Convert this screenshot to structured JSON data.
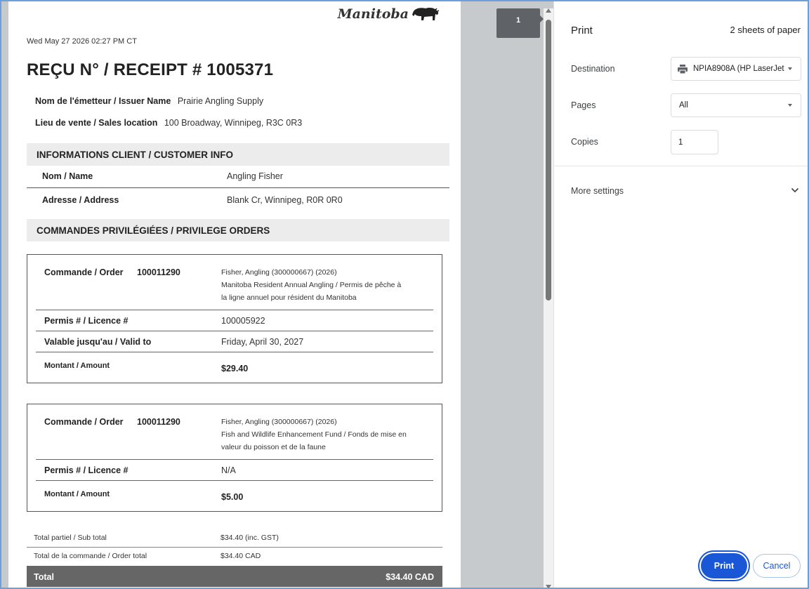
{
  "page": {
    "brand": "Manitoba",
    "timestamp": "Wed May 27 2026 02:27 PM CT",
    "receipt_title": "REÇU N° / RECEIPT # 1005371",
    "issuer": {
      "label": "Nom de l'émetteur / Issuer Name",
      "value": "Prairie Angling Supply"
    },
    "location": {
      "label": "Lieu de vente / Sales location",
      "value": "100 Broadway, Winnipeg, R3C 0R3"
    },
    "customer_section": "INFORMATIONS CLIENT / CUSTOMER INFO",
    "customer": [
      {
        "label": "Nom / Name",
        "value": "Angling Fisher"
      },
      {
        "label": "Adresse / Address",
        "value": "Blank Cr, Winnipeg, R0R 0R0"
      }
    ],
    "orders_section": "COMMANDES PRIVILÉGIÉES / PRIVILEGE ORDERS",
    "orders": [
      {
        "order_label": "Commande / Order",
        "order_number": "100011290",
        "desc_line1": "Fisher, Angling (300000667) (2026)",
        "desc_line2": "Manitoba Resident Annual Angling / Permis de pêche à",
        "desc_line3": "la ligne annuel pour résident du Manitoba",
        "licence_label": "Permis # / Licence #",
        "licence": "100005922",
        "valid_label": "Valable jusqu'au / Valid to",
        "valid": "Friday, April 30, 2027",
        "amount_label": "Montant / Amount",
        "amount": "$29.40"
      },
      {
        "order_label": "Commande / Order",
        "order_number": "100011290",
        "desc_line1": "Fisher, Angling (300000667) (2026)",
        "desc_line2": "Fish and Wildlife Enhancement Fund / Fonds de mise en",
        "desc_line3": "valeur du poisson et de la faune",
        "licence_label": "Permis # / Licence #",
        "licence": "N/A",
        "amount_label": "Montant / Amount",
        "amount": "$5.00"
      }
    ],
    "subtotal": {
      "label": "Total partiel / Sub total",
      "value": "$34.40 (inc. GST)"
    },
    "order_total": {
      "label": "Total de la commande / Order total",
      "value": "$34.40 CAD"
    },
    "total": {
      "label": "Total",
      "value": "$34.40 CAD"
    }
  },
  "page_badge": "1",
  "print_panel": {
    "title": "Print",
    "sheets": "2 sheets of paper",
    "destination_label": "Destination",
    "destination_value": "NPIA8908A (HP LaserJet",
    "pages_label": "Pages",
    "pages_value": "All",
    "copies_label": "Copies",
    "copies_value": "1",
    "more_settings": "More settings",
    "print_button": "Print",
    "cancel_button": "Cancel"
  },
  "colors": {
    "accent": "#1a57d6",
    "total_bar": "#666666",
    "section_bar": "#ececec"
  },
  "icons": [
    "bison-logo-icon",
    "printer-icon",
    "chevron-down-icon",
    "scroll-up-arrow-icon",
    "scroll-down-arrow-icon"
  ]
}
